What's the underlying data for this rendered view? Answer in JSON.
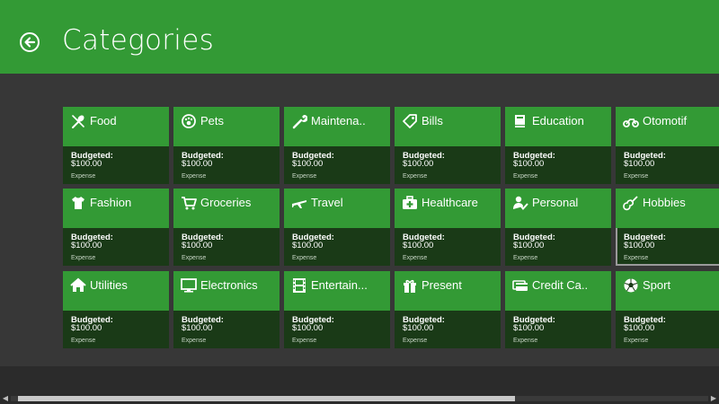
{
  "header": {
    "title": "Categories",
    "back_icon": "back-arrow-circle-icon"
  },
  "tiles": [
    {
      "name": "Food",
      "icon": "utensils-icon",
      "budget_label": "Budgeted:",
      "budget_value": "$100.00",
      "type": "Expense"
    },
    {
      "name": "Pets",
      "icon": "paw-icon",
      "budget_label": "Budgeted:",
      "budget_value": "$100.00",
      "type": "Expense"
    },
    {
      "name": "Maintena..",
      "icon": "wrench-icon",
      "budget_label": "Budgeted:",
      "budget_value": "$100.00",
      "type": "Expense"
    },
    {
      "name": "Bills",
      "icon": "tag-icon",
      "budget_label": "Budgeted:",
      "budget_value": "$100.00",
      "type": "Expense"
    },
    {
      "name": "Education",
      "icon": "book-icon",
      "budget_label": "Budgeted:",
      "budget_value": "$100.00",
      "type": "Expense"
    },
    {
      "name": "Otomotif",
      "icon": "motorcycle-icon",
      "budget_label": "Budgeted:",
      "budget_value": "$100.00",
      "type": "Expense"
    },
    {
      "name": "Fashion",
      "icon": "tshirt-icon",
      "budget_label": "Budgeted:",
      "budget_value": "$100.00",
      "type": "Expense"
    },
    {
      "name": "Groceries",
      "icon": "cart-icon",
      "budget_label": "Budgeted:",
      "budget_value": "$100.00",
      "type": "Expense"
    },
    {
      "name": "Travel",
      "icon": "airplane-icon",
      "budget_label": "Budgeted:",
      "budget_value": "$100.00",
      "type": "Expense"
    },
    {
      "name": "Healthcare",
      "icon": "medkit-icon",
      "budget_label": "Budgeted:",
      "budget_value": "$100.00",
      "type": "Expense"
    },
    {
      "name": "Personal",
      "icon": "person-check-icon",
      "budget_label": "Budgeted:",
      "budget_value": "$100.00",
      "type": "Expense"
    },
    {
      "name": "Hobbies",
      "icon": "guitar-icon",
      "budget_label": "Budgeted:",
      "budget_value": "$100.00",
      "type": "Expense",
      "selected": true
    },
    {
      "name": "Utilities",
      "icon": "home-icon",
      "budget_label": "Budgeted:",
      "budget_value": "$100.00",
      "type": "Expense"
    },
    {
      "name": "Electronics",
      "icon": "monitor-icon",
      "budget_label": "Budgeted:",
      "budget_value": "$100.00",
      "type": "Expense"
    },
    {
      "name": "Entertain...",
      "icon": "film-icon",
      "budget_label": "Budgeted:",
      "budget_value": "$100.00",
      "type": "Expense"
    },
    {
      "name": "Present",
      "icon": "gift-icon",
      "budget_label": "Budgeted:",
      "budget_value": "$100.00",
      "type": "Expense"
    },
    {
      "name": "Credit Ca..",
      "icon": "credit-card-icon",
      "budget_label": "Budgeted:",
      "budget_value": "$100.00",
      "type": "Expense"
    },
    {
      "name": "Sport",
      "icon": "soccer-ball-icon",
      "budget_label": "Budgeted:",
      "budget_value": "$100.00",
      "type": "Expense"
    }
  ],
  "colors": {
    "accent": "#339a35",
    "tile_bottom": "#1a3a17",
    "background": "#373737"
  }
}
